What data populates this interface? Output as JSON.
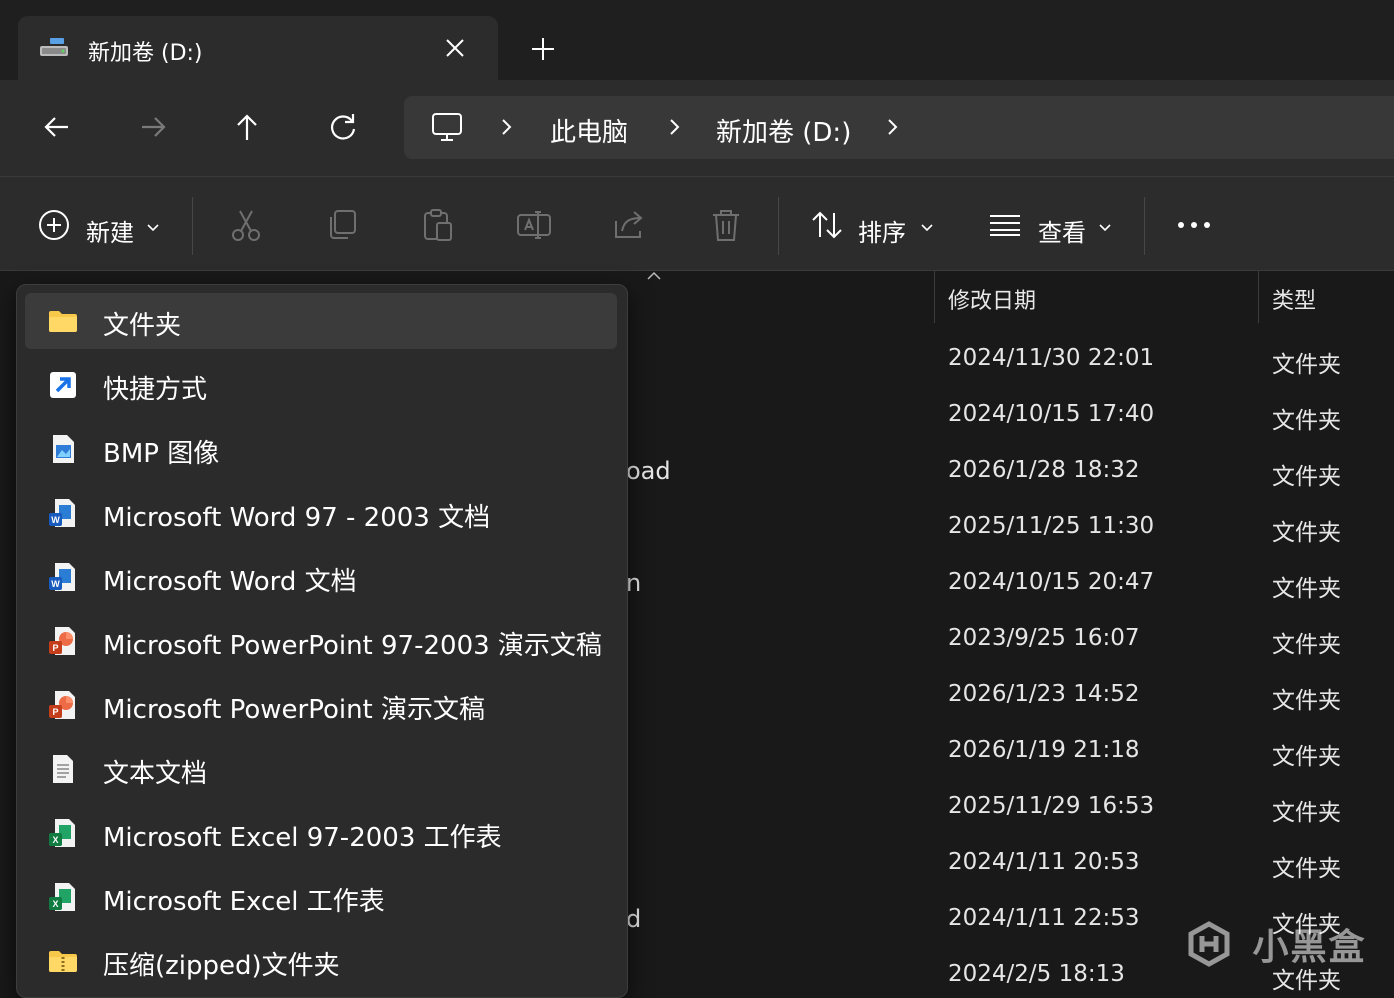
{
  "window": {
    "tab_title": "新加卷 (D:)",
    "tab_icon": "drive-icon"
  },
  "breadcrumb": {
    "items": [
      "此电脑",
      "新加卷 (D:)"
    ]
  },
  "toolbar": {
    "new_label": "新建",
    "sort_label": "排序",
    "view_label": "查看"
  },
  "columns": {
    "date": "修改日期",
    "type": "类型"
  },
  "files": [
    {
      "date": "2024/11/30 22:01",
      "type": "文件夹"
    },
    {
      "date": "2024/10/15 17:40",
      "type": "文件夹"
    },
    {
      "date": "2026/1/28 18:32",
      "type": "文件夹",
      "name_fragment": "oad"
    },
    {
      "date": "2025/11/25 11:30",
      "type": "文件夹"
    },
    {
      "date": "2024/10/15 20:47",
      "type": "文件夹",
      "name_fragment": "n"
    },
    {
      "date": "2023/9/25 16:07",
      "type": "文件夹"
    },
    {
      "date": "2026/1/23 14:52",
      "type": "文件夹"
    },
    {
      "date": "2026/1/19 21:18",
      "type": "文件夹"
    },
    {
      "date": "2025/11/29 16:53",
      "type": "文件夹"
    },
    {
      "date": "2024/1/11 20:53",
      "type": "文件夹"
    },
    {
      "date": "2024/1/11 22:53",
      "type": "文件夹",
      "name_fragment": "d"
    },
    {
      "date": "2024/2/5 18:13",
      "type": "文件夹"
    }
  ],
  "new_menu": {
    "items": [
      {
        "label": "文件夹",
        "icon": "folder-icon"
      },
      {
        "label": "快捷方式",
        "icon": "shortcut-icon"
      },
      {
        "label": "BMP 图像",
        "icon": "bmp-image-icon"
      },
      {
        "label": "Microsoft Word 97 - 2003 文档",
        "icon": "word-doc-icon"
      },
      {
        "label": "Microsoft Word 文档",
        "icon": "word-doc-icon"
      },
      {
        "label": "Microsoft PowerPoint 97-2003 演示文稿",
        "icon": "powerpoint-icon"
      },
      {
        "label": "Microsoft PowerPoint 演示文稿",
        "icon": "powerpoint-icon"
      },
      {
        "label": "文本文档",
        "icon": "text-doc-icon"
      },
      {
        "label": "Microsoft Excel 97-2003 工作表",
        "icon": "excel-icon"
      },
      {
        "label": "Microsoft Excel 工作表",
        "icon": "excel-icon"
      },
      {
        "label": "压缩(zipped)文件夹",
        "icon": "zip-folder-icon"
      }
    ]
  },
  "watermark": "小黑盒",
  "colors": {
    "background": "#1b1b1b",
    "panel": "#2c2c2c",
    "menu": "#2b2b2b",
    "folder_yellow": "#f8c84a"
  }
}
